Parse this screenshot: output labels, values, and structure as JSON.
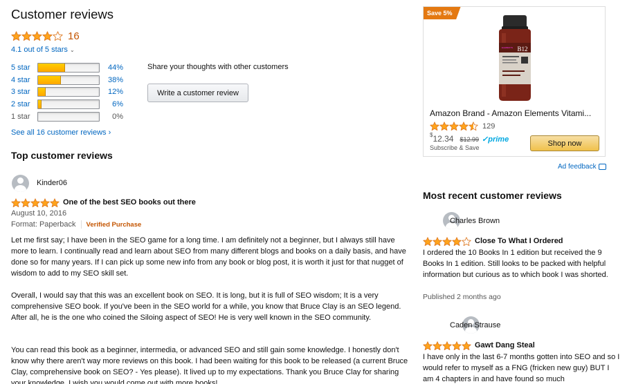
{
  "left": {
    "heading": "Customer reviews",
    "overall": {
      "rating": 4.1,
      "count": "16",
      "out_of": "4.1 out of 5 stars"
    },
    "histogram": [
      {
        "label": "5 star",
        "percent": 44,
        "pct_text": "44%"
      },
      {
        "label": "4 star",
        "percent": 38,
        "pct_text": "38%"
      },
      {
        "label": "3 star",
        "percent": 12,
        "pct_text": "12%"
      },
      {
        "label": "2 star",
        "percent": 6,
        "pct_text": "6%"
      },
      {
        "label": "1 star",
        "percent": 0,
        "pct_text": "0%"
      }
    ],
    "share_text": "Share your thoughts with other customers",
    "write_review": "Write a customer review",
    "see_all": "See all 16 customer reviews ›",
    "top_heading": "Top customer reviews"
  },
  "review1": {
    "name": "Kinder06",
    "rating": 5,
    "title": "One of the best SEO books out there",
    "date": "August 10, 2016",
    "format": "Format: Paperback",
    "verified": "Verified Purchase",
    "p1": "Let me first say; I have been in the SEO game for a long time. I am definitely not a beginner, but I always still have more to learn. I continually read and learn about SEO from many different blogs and books on a daily basis, and have done so for many years. If I can pick up some new info from any book or blog post, it is worth it just for that nugget of wisdom to add to my SEO skill set.",
    "p2": "Overall, I would say that this was an excellent book on SEO. It is long, but it is full of SEO wisdom; It is a very comprehensive SEO book. If you've been in the SEO world for a while, you know that Bruce Clay is an SEO legend. After all, he is the one who coined the Siloing aspect of SEO! He is very well known in the SEO community.",
    "p3": "You can read this book as a beginner, intermedia, or advanced SEO and still gain some knowledge. I honestly don't know why there aren't way more reviews on this book. I had been waiting for this book to be released (a current Bruce Clay, comprehensive book on SEO? - Yes please). It lived up to my expectations. Thank you Bruce Clay for sharing your knowledge. I wish you would come out with more books!"
  },
  "ad": {
    "badge": "Save 5%",
    "title": "Amazon Brand - Amazon Elements Vitami...",
    "rating": 4.5,
    "count": "129",
    "currency": "$",
    "price": "12.34",
    "old_price": "$12.99",
    "prime_a": "✓prime",
    "subscribe": "Subscribe & Save",
    "shop_now": "Shop now",
    "bottle_label": "B12",
    "bottle_brand": "ELEMENTS",
    "feedback": "Ad feedback"
  },
  "recent": {
    "heading": "Most recent customer reviews",
    "items": [
      {
        "name": "Charles Brown",
        "rating": 4,
        "title": "Close To What I Ordered",
        "body": "I ordered the 10 Books In 1 edition but received the 9 Books In 1 edition. Still looks to be packed with helpful information but curious as to which book I was shorted.",
        "date": "Published 2 months ago"
      },
      {
        "name": "Caden Strause",
        "rating": 5,
        "title": "Gawt Dang Steal",
        "body": "I have only in the last 6-7 months gotten into SEO and so I would refer to myself as a FNG (fricken new guy) BUT I am 4 chapters in and have found so much"
      }
    ]
  },
  "colors": {
    "star": "#ffa41c",
    "star_stroke": "#de7921",
    "link": "#0066c0",
    "orange": "#c45500",
    "badge": "#e47911"
  }
}
